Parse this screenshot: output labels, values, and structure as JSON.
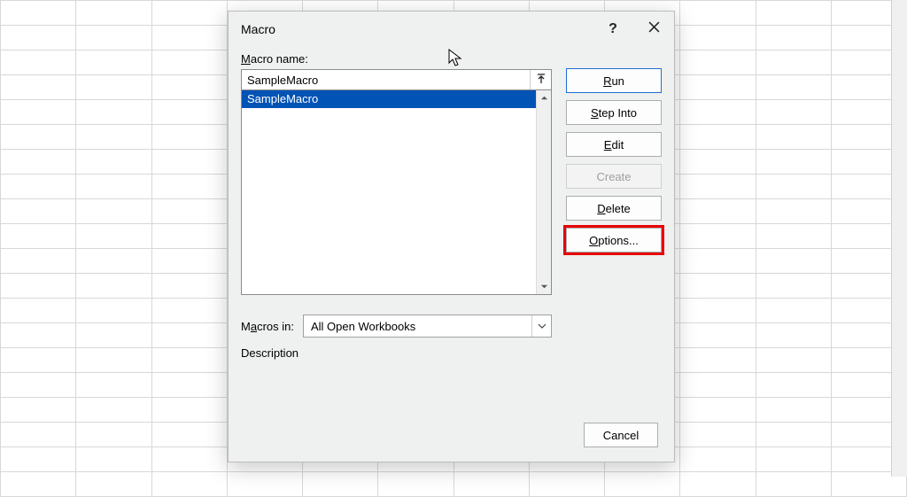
{
  "dialog": {
    "title": "Macro",
    "help_tooltip": "?",
    "close_tooltip": "Close"
  },
  "fields": {
    "macro_name_label": "Macro name:",
    "macro_name_value": "SampleMacro",
    "macros_in_label": "Macros in:",
    "macros_in_value": "All Open Workbooks",
    "description_label": "Description"
  },
  "macro_list": [
    {
      "label": "SampleMacro",
      "selected": true
    }
  ],
  "buttons": {
    "run": {
      "pre": "",
      "u": "R",
      "post": "un"
    },
    "step_into": {
      "pre": "",
      "u": "S",
      "post": "tep Into"
    },
    "edit": {
      "pre": "",
      "u": "E",
      "post": "dit"
    },
    "create": {
      "pre": "",
      "u": "",
      "post": "Create"
    },
    "delete": {
      "pre": "",
      "u": "D",
      "post": "elete"
    },
    "options": {
      "pre": "",
      "u": "O",
      "post": "ptions..."
    },
    "cancel": "Cancel"
  }
}
